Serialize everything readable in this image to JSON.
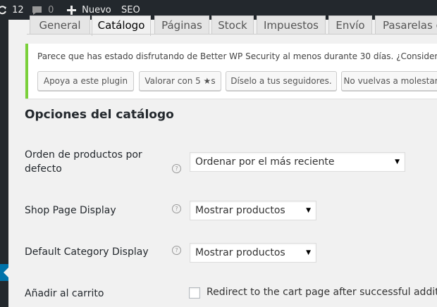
{
  "adminbar": {
    "updates_count": "12",
    "comments_count": "0",
    "new_label": "Nuevo",
    "seo_label": "SEO"
  },
  "tabs": [
    {
      "label": "General",
      "active": false
    },
    {
      "label": "Catálogo",
      "active": true
    },
    {
      "label": "Páginas",
      "active": false
    },
    {
      "label": "Stock",
      "active": false
    },
    {
      "label": "Impuestos",
      "active": false
    },
    {
      "label": "Envío",
      "active": false
    },
    {
      "label": "Pasarelas de pago",
      "active": false
    }
  ],
  "notice": {
    "text": "Parece que has estado disfrutando de Better WP Security al menos durante 30 días. ¿Considerarías",
    "buttons": [
      "Apoya a este plugin",
      "Valorar con 5 ★s",
      "Díselo a tus seguidores.",
      "No vuelvas a molestarme"
    ]
  },
  "section": {
    "title": "Opciones del catálogo",
    "rows": [
      {
        "label": "Orden de productos por defecto",
        "value": "Ordenar por el más reciente"
      },
      {
        "label": "Shop Page Display",
        "value": "Mostrar productos"
      },
      {
        "label": "Default Category Display",
        "value": "Mostrar productos"
      },
      {
        "label": "Añadir al carrito",
        "checkbox_label": "Redirect to the cart page after successful addition",
        "checked": false
      }
    ]
  },
  "colors": {
    "adminbar_bg": "#23282d",
    "notice_border": "#7ad03a",
    "sidebar_accent": "#0073aa"
  }
}
